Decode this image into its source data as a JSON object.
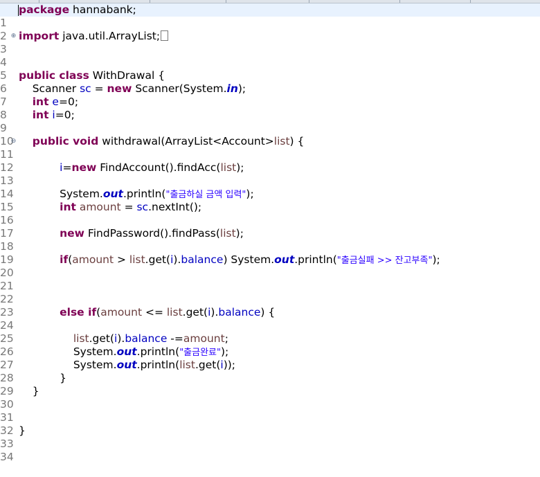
{
  "editor": {
    "language": "java",
    "colors": {
      "keyword": "#7f0055",
      "field": "#0000c0",
      "local_variable": "#6a3e3e",
      "string": "#2a00ff",
      "line_number": "#787878",
      "current_line": "#e8f2fe"
    },
    "lines": [
      {
        "n": "1"
      },
      {
        "n": "2"
      },
      {
        "n": "3"
      },
      {
        "n": "4"
      },
      {
        "n": "5"
      },
      {
        "n": "6"
      },
      {
        "n": "7"
      },
      {
        "n": "8"
      },
      {
        "n": "9"
      },
      {
        "n": "10"
      },
      {
        "n": "11"
      },
      {
        "n": "12"
      },
      {
        "n": "13"
      },
      {
        "n": "14"
      },
      {
        "n": "15"
      },
      {
        "n": "16"
      },
      {
        "n": "17"
      },
      {
        "n": "18"
      },
      {
        "n": "19"
      },
      {
        "n": "20"
      },
      {
        "n": "21"
      },
      {
        "n": "22"
      },
      {
        "n": "23"
      },
      {
        "n": "24"
      },
      {
        "n": "25"
      },
      {
        "n": "26"
      },
      {
        "n": "27"
      },
      {
        "n": "28"
      },
      {
        "n": "29"
      },
      {
        "n": "30"
      },
      {
        "n": "31"
      },
      {
        "n": "32"
      },
      {
        "n": "33"
      },
      {
        "n": "34"
      }
    ],
    "tokens": {
      "l1": {
        "kw": "package",
        "rest": " hannabank;"
      },
      "l3": {
        "kw": "import",
        "rest": " java.util.ArrayList;"
      },
      "l6": {
        "kw": "public class",
        "rest": " WithDrawal {"
      },
      "l7": {
        "a": "    Scanner ",
        "fld": "sc",
        "b": " = ",
        "kw": "new",
        "c": " Scanner(System.",
        "sfld": "in",
        "d": ");"
      },
      "l8": {
        "a": "    ",
        "kw": "int",
        "b": " ",
        "fld": "e",
        "c": "=0;"
      },
      "l9": {
        "a": "    ",
        "kw": "int",
        "b": " ",
        "fld": "i",
        "c": "=0;"
      },
      "l11": {
        "a": "    ",
        "kw": "public void",
        "b": " withdrawal(ArrayList<Account>",
        "var": "list",
        "c": ") {"
      },
      "l13": {
        "a": "            ",
        "fld": "i",
        "b": "=",
        "kw": "new",
        "c": " FindAccount().findAcc(",
        "var": "list",
        "d": ");"
      },
      "l15": {
        "a": "            System.",
        "sfld": "out",
        "b": ".println(",
        "str": "\"출금하실 금액 입력\"",
        "c": ");"
      },
      "l16": {
        "a": "            ",
        "kw": "int",
        "b": " ",
        "var": "amount",
        "c": " = ",
        "fld": "sc",
        "d": ".nextInt();"
      },
      "l18": {
        "a": "            ",
        "kw": "new",
        "b": " FindPassword().findPass(",
        "var": "list",
        "c": ");"
      },
      "l20": {
        "a": "            ",
        "kw": "if",
        "b": "(",
        "var1": "amount",
        "c": " > ",
        "var2": "list",
        "d": ".get(",
        "fld1": "i",
        "e": ").",
        "fld2": "balance",
        "f": ") System.",
        "sfld": "out",
        "g": ".println(",
        "str": "\"출금실패 >> 잔고부족\"",
        "h": ");"
      },
      "l24": {
        "a": "            ",
        "kw": "else if",
        "b": "(",
        "var1": "amount",
        "c": " <= ",
        "var2": "list",
        "d": ".get(",
        "fld1": "i",
        "e": ").",
        "fld2": "balance",
        "f": ") {"
      },
      "l26": {
        "a": "                ",
        "var1": "list",
        "b": ".get(",
        "fld1": "i",
        "c": ").",
        "fld2": "balance",
        "d": " -=",
        "var2": "amount",
        "e": ";"
      },
      "l27": {
        "a": "                System.",
        "sfld": "out",
        "b": ".println(",
        "str": "\"출금완료\"",
        "c": ");"
      },
      "l28": {
        "a": "                System.",
        "sfld": "out",
        "b": ".println(",
        "var": "list",
        "c": ".get(",
        "fld": "i",
        "d": "));"
      },
      "l29": {
        "a": "            }"
      },
      "l30": {
        "a": "    }"
      },
      "l33": {
        "a": "}"
      }
    },
    "fold_markers": {
      "l3": "⊕",
      "l11": "⊖"
    }
  }
}
